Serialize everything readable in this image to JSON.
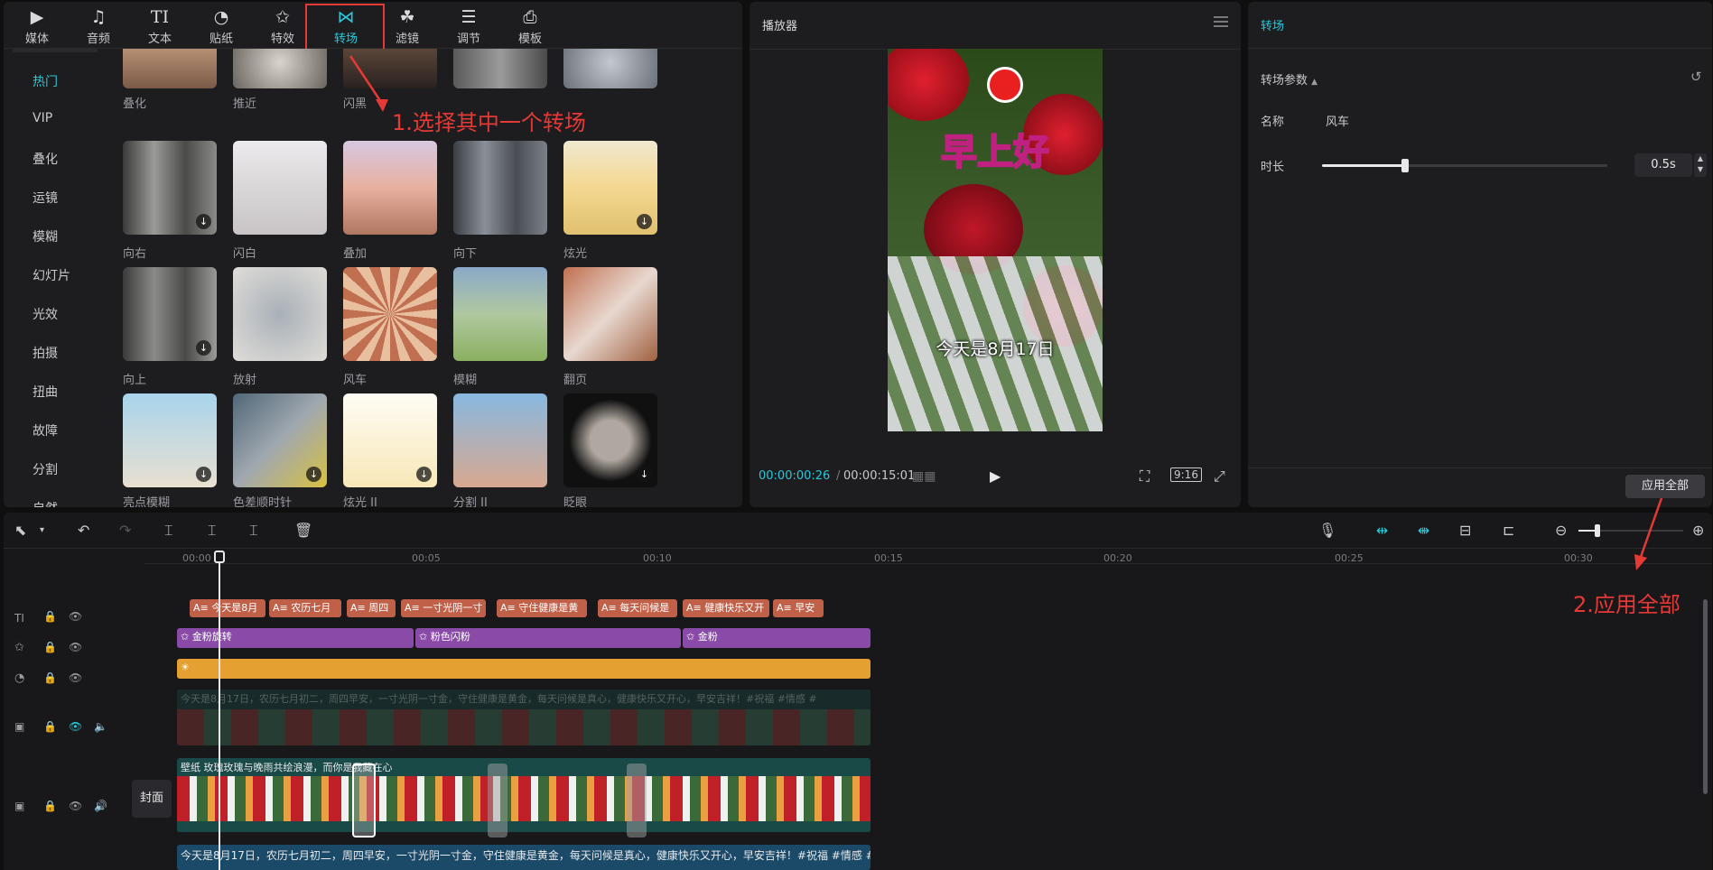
{
  "toolbar": {
    "tabs": [
      {
        "label": "媒体",
        "icon": "media-icon"
      },
      {
        "label": "音频",
        "icon": "audio-icon"
      },
      {
        "label": "文本",
        "icon": "text-icon"
      },
      {
        "label": "贴纸",
        "icon": "sticker-icon"
      },
      {
        "label": "特效",
        "icon": "effects-icon"
      },
      {
        "label": "转场",
        "icon": "transition-icon"
      },
      {
        "label": "滤镜",
        "icon": "filter-icon"
      },
      {
        "label": "调节",
        "icon": "adjust-icon"
      },
      {
        "label": "模板",
        "icon": "template-icon"
      }
    ],
    "active": "转场"
  },
  "categories": [
    "热门",
    "VIP",
    "叠化",
    "运镜",
    "模糊",
    "幻灯片",
    "光效",
    "拍摄",
    "扭曲",
    "故障",
    "分割",
    "自然"
  ],
  "transitions": {
    "row0": [
      "叠化",
      "推近",
      "闪黑",
      "",
      ""
    ],
    "row1": [
      "向右",
      "闪白",
      "叠加",
      "向下",
      "炫光"
    ],
    "row2": [
      "向上",
      "放射",
      "风车",
      "模糊",
      "翻页"
    ],
    "row3": [
      "亮点模糊",
      "色差顺时针",
      "炫光 II",
      "分割 II",
      "眨眼"
    ]
  },
  "annotations": {
    "step1": "1.选择其中一个转场",
    "step2": "2.应用全部"
  },
  "player": {
    "title": "播放器",
    "current_time": "00:00:00:26",
    "total_time": "00:00:15:01",
    "ratio": "9:16",
    "video_title": "早上好",
    "video_subtitle": "今天是8月17日"
  },
  "properties": {
    "title": "转场",
    "section": "转场参数",
    "name_label": "名称",
    "name_value": "风车",
    "duration_label": "时长",
    "duration_value": "0.5s",
    "duration_fraction": 0.29,
    "apply_all": "应用全部"
  },
  "timeline": {
    "ruler": [
      "00:00",
      "00:05",
      "00:10",
      "00:15",
      "00:20",
      "00:25",
      "00:30"
    ],
    "text_clips": [
      "今天是8月",
      "农历七月",
      "周四",
      "一寸光阴一寸",
      "守住健康是黄",
      "每天问候是",
      "健康快乐又开",
      "早安"
    ],
    "effect_clips": [
      "金粉旋转",
      "粉色闪粉",
      "金粉"
    ],
    "video_caption": "今天是8月17日，农历七月初二，周四早安，一寸光阴一寸金，守住健康是黄金，每天问候是真心，健康快乐又开心，早安吉祥！#祝福 #情感 #",
    "video_caption_faded": "今天是8月17日，农历七月初二，周四早安，一寸光阴一寸金，守住健康是黄金，每天问候是真心，健康快乐又开心，早安吉祥！#祝福 #情感 #",
    "main_clip_title": "壁纸  玫瑰玫瑰与晚雨共绘浪漫，而你是我藏在心",
    "cover_label": "封面"
  }
}
